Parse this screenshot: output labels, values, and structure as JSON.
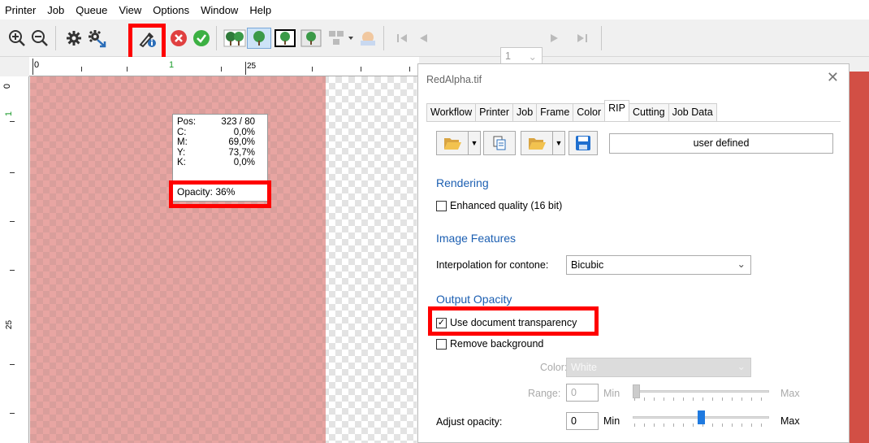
{
  "menu": [
    "Printer",
    "Job",
    "Queue",
    "View",
    "Options",
    "Window",
    "Help"
  ],
  "toolbar": {
    "icons": [
      "zoom-in-icon",
      "zoom-out-icon",
      "gear-icon",
      "gear-arrow-icon",
      "eyedropper-info-icon",
      "cancel-icon",
      "ok-icon",
      "tree-pair-icon",
      "tree-icon",
      "tree-frame-icon",
      "tree-color-icon",
      "tree-split-icon",
      "tree-faded-icon",
      "first-page-icon",
      "prev-page-icon",
      "next-page-icon",
      "last-page-icon"
    ],
    "page_value": "1"
  },
  "ruler": {
    "top_labels": [
      "0",
      "1",
      "25"
    ],
    "left_labels": [
      "0",
      "1",
      "25"
    ]
  },
  "pixel_info": {
    "pos_label": "Pos:",
    "pos_value": "323 / 80",
    "c_label": "C:",
    "c_value": "0,0%",
    "m_label": "M:",
    "m_value": "69,0%",
    "y_label": "Y:",
    "y_value": "73,7%",
    "k_label": "K:",
    "k_value": "0,0%",
    "opacity_label": "Opacity:",
    "opacity_value": "36%"
  },
  "dialog": {
    "title": "RedAlpha.tif",
    "tabs": [
      "Workflow",
      "Printer",
      "Job",
      "Frame",
      "Color",
      "RIP",
      "Cutting",
      "Job Data"
    ],
    "active_tab": "RIP",
    "preset_value": "user defined",
    "rendering": {
      "heading": "Rendering",
      "enhanced_label": "Enhanced quality (16 bit)",
      "enhanced_checked": false
    },
    "image_features": {
      "heading": "Image Features",
      "interp_label": "Interpolation for contone:",
      "interp_value": "Bicubic"
    },
    "output_opacity": {
      "heading": "Output Opacity",
      "use_transparency_label": "Use document transparency",
      "use_transparency_checked": true,
      "remove_bg_label": "Remove background",
      "remove_bg_checked": false,
      "color_label": "Color:",
      "color_value": "White",
      "range_label": "Range:",
      "range_value": "0",
      "range_min": "Min",
      "range_max": "Max",
      "range_level": 0,
      "adjust_label": "Adjust opacity:",
      "adjust_value": "0",
      "adjust_min": "Min",
      "adjust_max": "Max",
      "adjust_level": 0.5
    }
  },
  "colors": {
    "accent": "#1c5fb2",
    "highlight": "#ff0000",
    "image_red": "#d24f45"
  }
}
